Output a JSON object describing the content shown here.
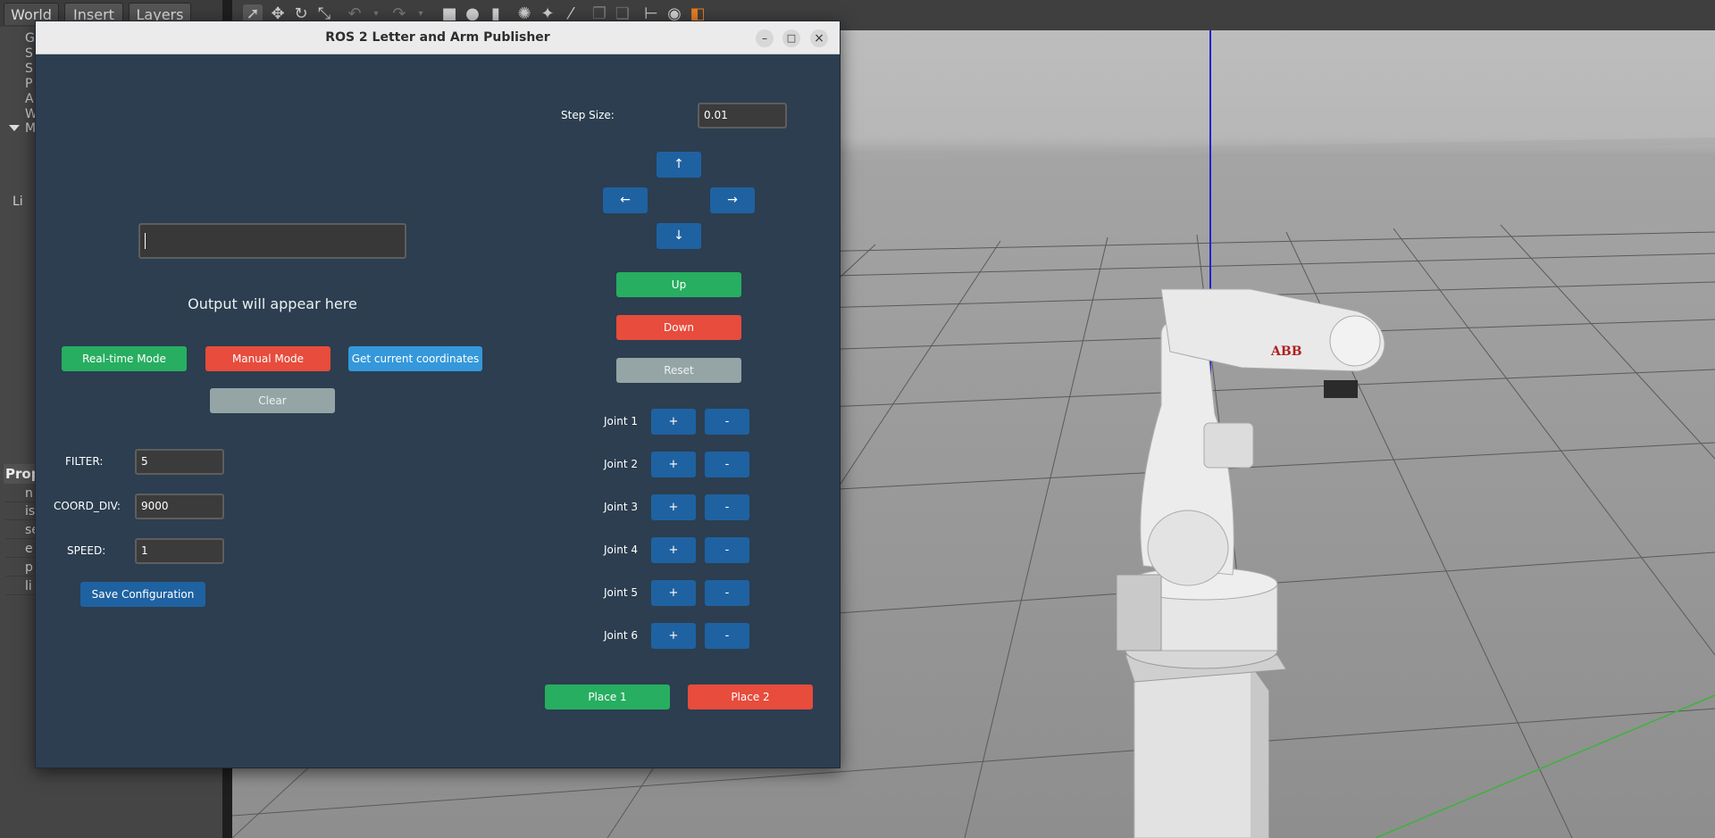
{
  "background_app": {
    "tabs": [
      "World",
      "Insert",
      "Layers"
    ],
    "tree_items": [
      "G",
      "S",
      "S",
      "P",
      "A",
      "W",
      "M",
      "",
      "",
      "Li"
    ],
    "properties_header": "Prop",
    "property_rows": [
      "n",
      "is",
      "se",
      "e",
      "p",
      "li"
    ]
  },
  "window": {
    "title": "ROS 2 Letter and Arm Publisher",
    "minimize": "–",
    "maximize": "□",
    "close": "×"
  },
  "left_panel": {
    "letter_input_value": "",
    "output_text": "Output will appear here",
    "realtime_mode": "Real-time Mode",
    "manual_mode": "Manual Mode",
    "get_coordinates": "Get current coordinates",
    "clear": "Clear",
    "filter_label": "FILTER:",
    "filter_value": "5",
    "coord_div_label": "COORD_DIV:",
    "coord_div_value": "9000",
    "speed_label": "SPEED:",
    "speed_value": "1",
    "save_config": "Save Configuration"
  },
  "right_panel": {
    "step_size_label": "Step Size:",
    "step_size_value": "0.01",
    "arrow_up": "↑",
    "arrow_left": "←",
    "arrow_right": "→",
    "arrow_down": "↓",
    "up": "Up",
    "down": "Down",
    "reset": "Reset",
    "joints": [
      {
        "label": "Joint 1",
        "plus": "+",
        "minus": "-"
      },
      {
        "label": "Joint 2",
        "plus": "+",
        "minus": "-"
      },
      {
        "label": "Joint 3",
        "plus": "+",
        "minus": "-"
      },
      {
        "label": "Joint 4",
        "plus": "+",
        "minus": "-"
      },
      {
        "label": "Joint 5",
        "plus": "+",
        "minus": "-"
      },
      {
        "label": "Joint 6",
        "plus": "+",
        "minus": "-"
      }
    ],
    "place1": "Place 1",
    "place2": "Place 2"
  },
  "robot": {
    "brand": "ABB"
  },
  "colors": {
    "dialog_bg": "#2c3e50",
    "green": "#27ae60",
    "red": "#e74c3c",
    "blue": "#1f62a1",
    "light_blue": "#3498db",
    "gray": "#95a5a6"
  }
}
